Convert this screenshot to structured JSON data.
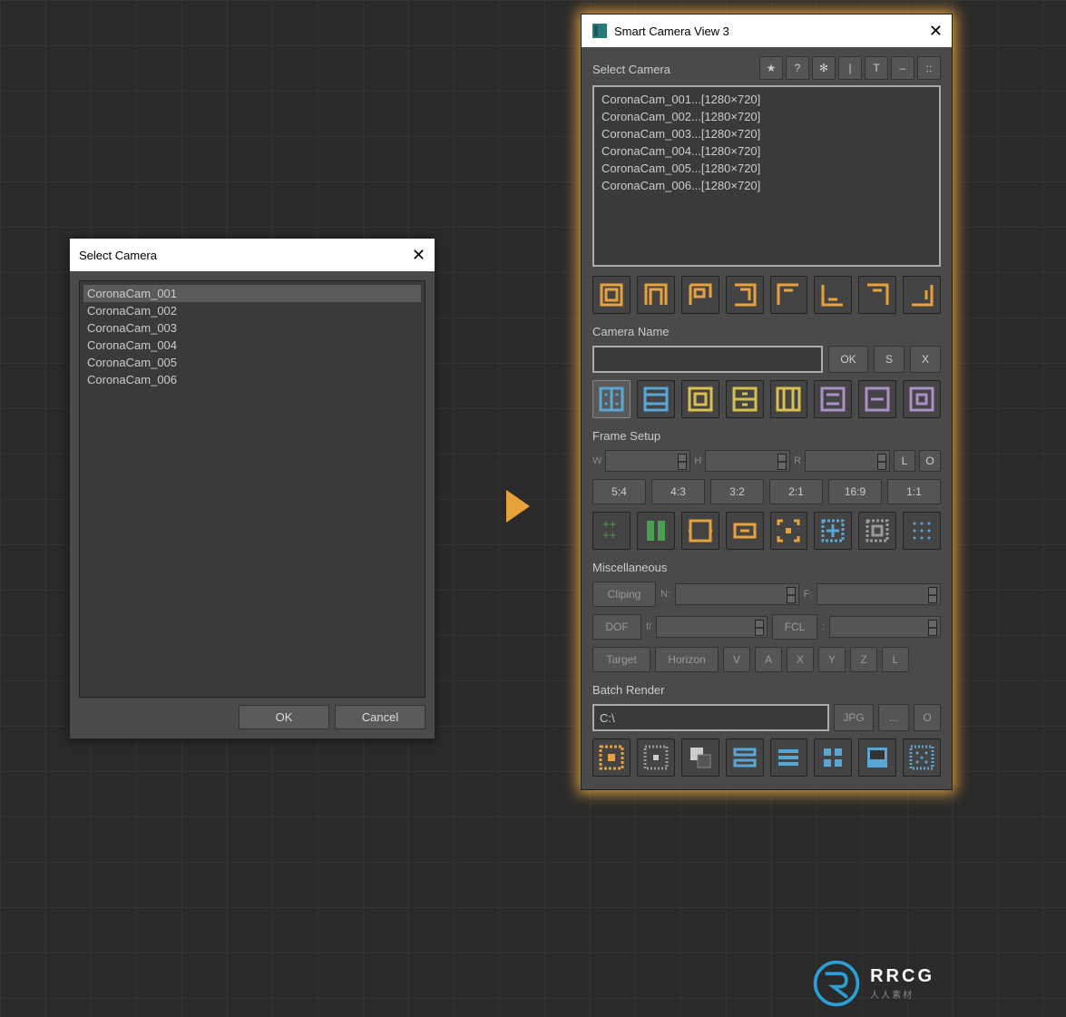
{
  "leftDialog": {
    "title": "Select Camera",
    "cameras": [
      "CoronaCam_001",
      "CoronaCam_002",
      "CoronaCam_003",
      "CoronaCam_004",
      "CoronaCam_005",
      "CoronaCam_006"
    ],
    "okLabel": "OK",
    "cancelLabel": "Cancel"
  },
  "smart": {
    "title": "Smart Camera View 3",
    "selectLabel": "Select Camera",
    "topIcons": {
      "star": "★",
      "help": "?",
      "gear": "✻",
      "bar": "|",
      "text": "T",
      "minus": "–",
      "dots": "::"
    },
    "cameras": [
      "CoronaCam_001...[1280×720]",
      "CoronaCam_002...[1280×720]",
      "CoronaCam_003...[1280×720]",
      "CoronaCam_004...[1280×720]",
      "CoronaCam_005...[1280×720]",
      "CoronaCam_006...[1280×720]"
    ],
    "cameraNameLabel": "Camera Name",
    "okLabel": "OK",
    "sLabel": "S",
    "xLabel": "X",
    "frameSetupLabel": "Frame Setup",
    "frameFields": {
      "w": "W",
      "h": "H",
      "r": "R",
      "l": "L",
      "o": "O"
    },
    "ratios": [
      "5:4",
      "4:3",
      "3:2",
      "2:1",
      "16:9",
      "1:1"
    ],
    "miscLabel": "Miscellaneous",
    "clipingLabel": "Cliping",
    "nLabel": "N:",
    "fLabel": "F:",
    "dofLabel": "DOF",
    "fSlash": "f/",
    "fclLabel": "FCL",
    "colon": ":",
    "targetLabel": "Target",
    "horizonLabel": "Horizon",
    "horizBtns": [
      "V",
      "A",
      "X",
      "Y",
      "Z",
      "L"
    ],
    "batchLabel": "Batch Render",
    "batchPath": "C:\\",
    "jpgLabel": "JPG",
    "dotsLabel": "...",
    "oLabel": "O"
  },
  "watermark": {
    "brand": "RRCG",
    "sub": "人人素材"
  }
}
